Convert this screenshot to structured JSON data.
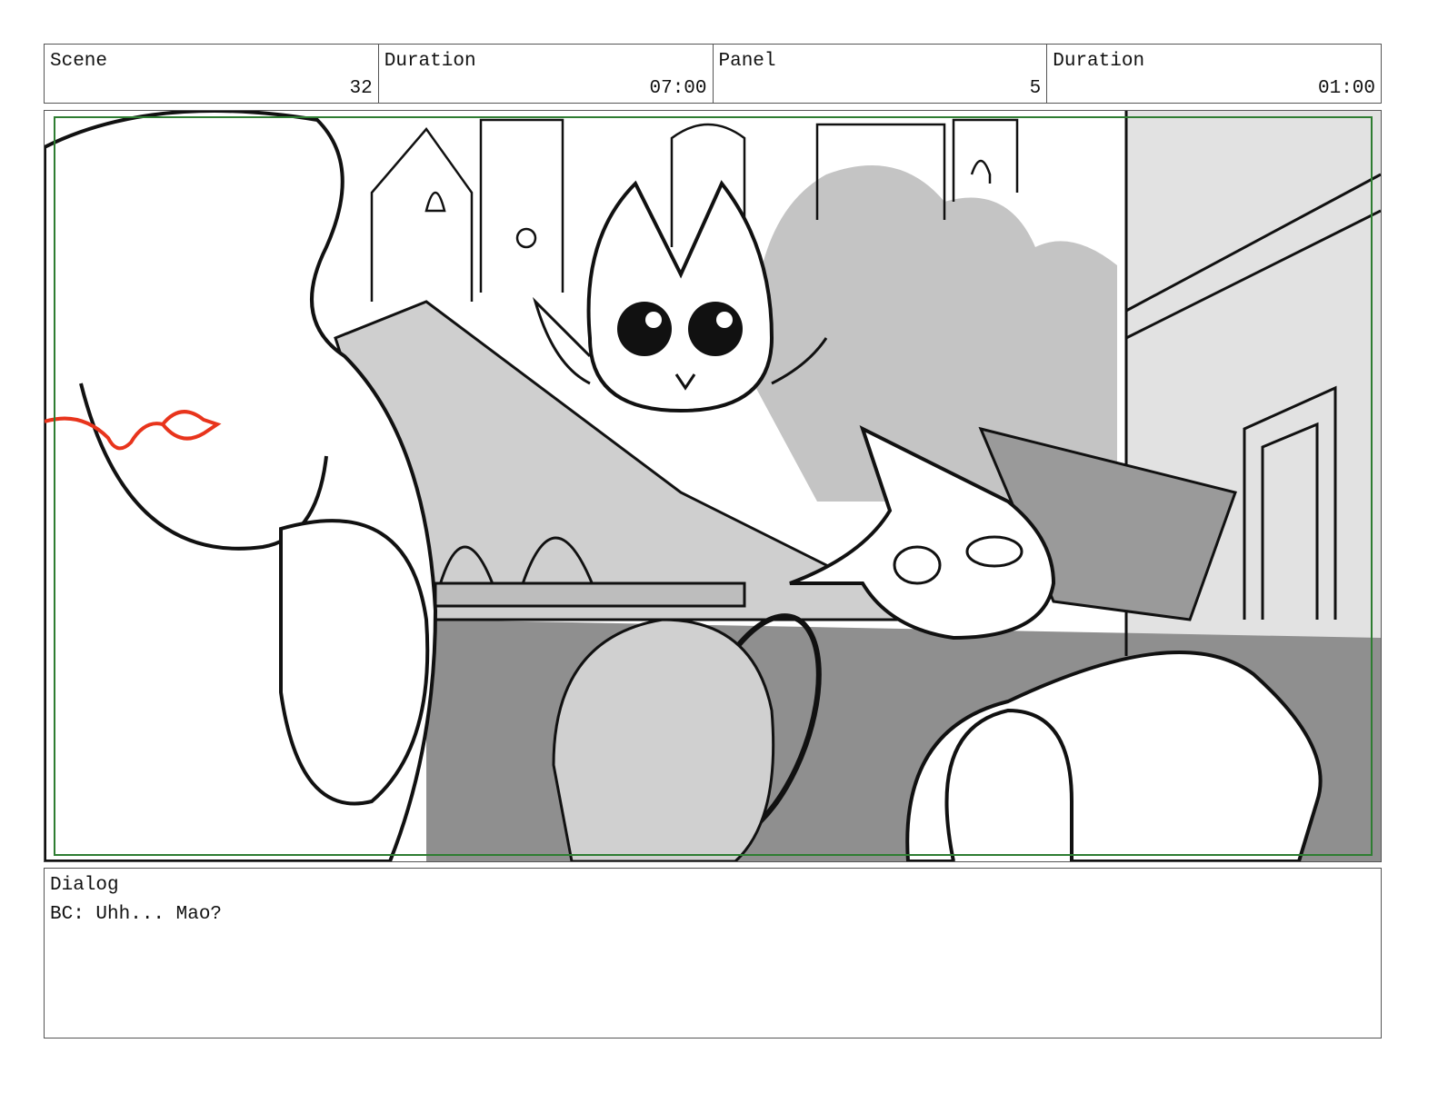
{
  "header": {
    "scene_label": "Scene",
    "scene_value": "32",
    "scene_duration_label": "Duration",
    "scene_duration_value": "07:00",
    "panel_label": "Panel",
    "panel_value": "5",
    "panel_duration_label": "Duration",
    "panel_duration_value": "01:00"
  },
  "dialog": {
    "label": "Dialog",
    "text": "BC: Uhh... Mao?"
  },
  "colors": {
    "safe_area_border": "#2e7d32",
    "annotation_arrow": "#e8341c",
    "sketch_line": "#111111",
    "fill_light": "#d4d4d4",
    "fill_mid": "#a8a8a8",
    "fill_dark": "#8c8c8c"
  }
}
